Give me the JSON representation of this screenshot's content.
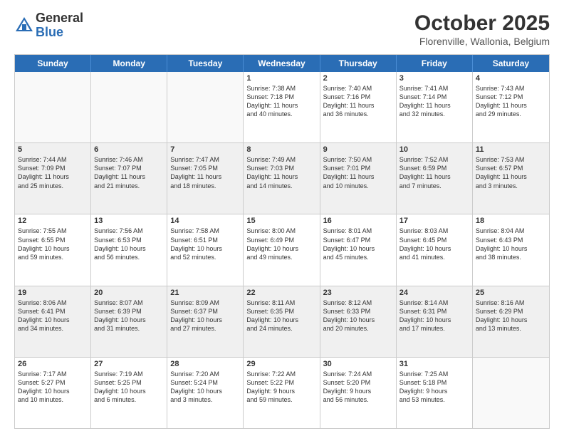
{
  "header": {
    "logo_general": "General",
    "logo_blue": "Blue",
    "month": "October 2025",
    "location": "Florenville, Wallonia, Belgium"
  },
  "weekdays": [
    "Sunday",
    "Monday",
    "Tuesday",
    "Wednesday",
    "Thursday",
    "Friday",
    "Saturday"
  ],
  "rows": [
    [
      {
        "day": "",
        "lines": []
      },
      {
        "day": "",
        "lines": []
      },
      {
        "day": "",
        "lines": []
      },
      {
        "day": "1",
        "lines": [
          "Sunrise: 7:38 AM",
          "Sunset: 7:18 PM",
          "Daylight: 11 hours",
          "and 40 minutes."
        ]
      },
      {
        "day": "2",
        "lines": [
          "Sunrise: 7:40 AM",
          "Sunset: 7:16 PM",
          "Daylight: 11 hours",
          "and 36 minutes."
        ]
      },
      {
        "day": "3",
        "lines": [
          "Sunrise: 7:41 AM",
          "Sunset: 7:14 PM",
          "Daylight: 11 hours",
          "and 32 minutes."
        ]
      },
      {
        "day": "4",
        "lines": [
          "Sunrise: 7:43 AM",
          "Sunset: 7:12 PM",
          "Daylight: 11 hours",
          "and 29 minutes."
        ]
      }
    ],
    [
      {
        "day": "5",
        "lines": [
          "Sunrise: 7:44 AM",
          "Sunset: 7:09 PM",
          "Daylight: 11 hours",
          "and 25 minutes."
        ]
      },
      {
        "day": "6",
        "lines": [
          "Sunrise: 7:46 AM",
          "Sunset: 7:07 PM",
          "Daylight: 11 hours",
          "and 21 minutes."
        ]
      },
      {
        "day": "7",
        "lines": [
          "Sunrise: 7:47 AM",
          "Sunset: 7:05 PM",
          "Daylight: 11 hours",
          "and 18 minutes."
        ]
      },
      {
        "day": "8",
        "lines": [
          "Sunrise: 7:49 AM",
          "Sunset: 7:03 PM",
          "Daylight: 11 hours",
          "and 14 minutes."
        ]
      },
      {
        "day": "9",
        "lines": [
          "Sunrise: 7:50 AM",
          "Sunset: 7:01 PM",
          "Daylight: 11 hours",
          "and 10 minutes."
        ]
      },
      {
        "day": "10",
        "lines": [
          "Sunrise: 7:52 AM",
          "Sunset: 6:59 PM",
          "Daylight: 11 hours",
          "and 7 minutes."
        ]
      },
      {
        "day": "11",
        "lines": [
          "Sunrise: 7:53 AM",
          "Sunset: 6:57 PM",
          "Daylight: 11 hours",
          "and 3 minutes."
        ]
      }
    ],
    [
      {
        "day": "12",
        "lines": [
          "Sunrise: 7:55 AM",
          "Sunset: 6:55 PM",
          "Daylight: 10 hours",
          "and 59 minutes."
        ]
      },
      {
        "day": "13",
        "lines": [
          "Sunrise: 7:56 AM",
          "Sunset: 6:53 PM",
          "Daylight: 10 hours",
          "and 56 minutes."
        ]
      },
      {
        "day": "14",
        "lines": [
          "Sunrise: 7:58 AM",
          "Sunset: 6:51 PM",
          "Daylight: 10 hours",
          "and 52 minutes."
        ]
      },
      {
        "day": "15",
        "lines": [
          "Sunrise: 8:00 AM",
          "Sunset: 6:49 PM",
          "Daylight: 10 hours",
          "and 49 minutes."
        ]
      },
      {
        "day": "16",
        "lines": [
          "Sunrise: 8:01 AM",
          "Sunset: 6:47 PM",
          "Daylight: 10 hours",
          "and 45 minutes."
        ]
      },
      {
        "day": "17",
        "lines": [
          "Sunrise: 8:03 AM",
          "Sunset: 6:45 PM",
          "Daylight: 10 hours",
          "and 41 minutes."
        ]
      },
      {
        "day": "18",
        "lines": [
          "Sunrise: 8:04 AM",
          "Sunset: 6:43 PM",
          "Daylight: 10 hours",
          "and 38 minutes."
        ]
      }
    ],
    [
      {
        "day": "19",
        "lines": [
          "Sunrise: 8:06 AM",
          "Sunset: 6:41 PM",
          "Daylight: 10 hours",
          "and 34 minutes."
        ]
      },
      {
        "day": "20",
        "lines": [
          "Sunrise: 8:07 AM",
          "Sunset: 6:39 PM",
          "Daylight: 10 hours",
          "and 31 minutes."
        ]
      },
      {
        "day": "21",
        "lines": [
          "Sunrise: 8:09 AM",
          "Sunset: 6:37 PM",
          "Daylight: 10 hours",
          "and 27 minutes."
        ]
      },
      {
        "day": "22",
        "lines": [
          "Sunrise: 8:11 AM",
          "Sunset: 6:35 PM",
          "Daylight: 10 hours",
          "and 24 minutes."
        ]
      },
      {
        "day": "23",
        "lines": [
          "Sunrise: 8:12 AM",
          "Sunset: 6:33 PM",
          "Daylight: 10 hours",
          "and 20 minutes."
        ]
      },
      {
        "day": "24",
        "lines": [
          "Sunrise: 8:14 AM",
          "Sunset: 6:31 PM",
          "Daylight: 10 hours",
          "and 17 minutes."
        ]
      },
      {
        "day": "25",
        "lines": [
          "Sunrise: 8:16 AM",
          "Sunset: 6:29 PM",
          "Daylight: 10 hours",
          "and 13 minutes."
        ]
      }
    ],
    [
      {
        "day": "26",
        "lines": [
          "Sunrise: 7:17 AM",
          "Sunset: 5:27 PM",
          "Daylight: 10 hours",
          "and 10 minutes."
        ]
      },
      {
        "day": "27",
        "lines": [
          "Sunrise: 7:19 AM",
          "Sunset: 5:25 PM",
          "Daylight: 10 hours",
          "and 6 minutes."
        ]
      },
      {
        "day": "28",
        "lines": [
          "Sunrise: 7:20 AM",
          "Sunset: 5:24 PM",
          "Daylight: 10 hours",
          "and 3 minutes."
        ]
      },
      {
        "day": "29",
        "lines": [
          "Sunrise: 7:22 AM",
          "Sunset: 5:22 PM",
          "Daylight: 9 hours",
          "and 59 minutes."
        ]
      },
      {
        "day": "30",
        "lines": [
          "Sunrise: 7:24 AM",
          "Sunset: 5:20 PM",
          "Daylight: 9 hours",
          "and 56 minutes."
        ]
      },
      {
        "day": "31",
        "lines": [
          "Sunrise: 7:25 AM",
          "Sunset: 5:18 PM",
          "Daylight: 9 hours",
          "and 53 minutes."
        ]
      },
      {
        "day": "",
        "lines": []
      }
    ]
  ]
}
